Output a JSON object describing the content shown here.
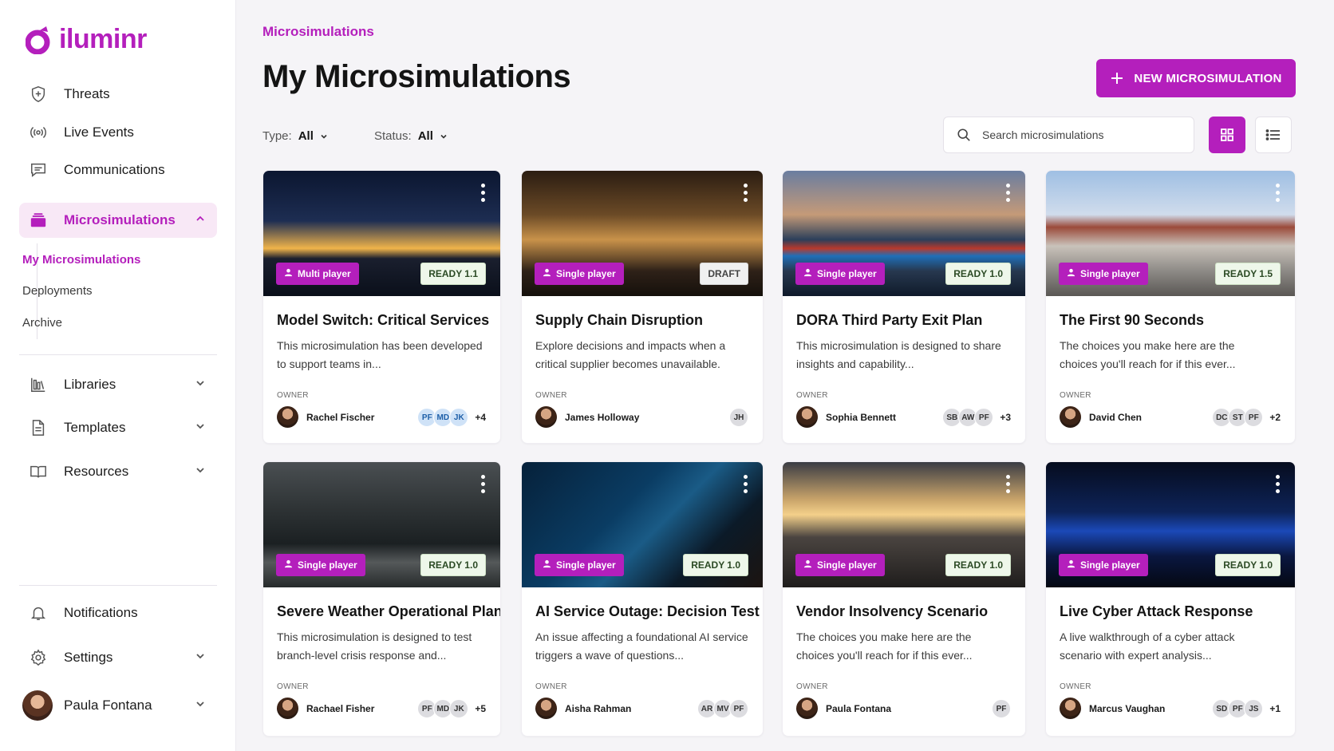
{
  "app": {
    "name": "iluminr"
  },
  "sidebar": {
    "items": [
      {
        "label": "Threats",
        "icon": "shield-icon"
      },
      {
        "label": "Live Events",
        "icon": "broadcast-icon"
      },
      {
        "label": "Communications",
        "icon": "message-icon"
      },
      {
        "label": "Microsimulations",
        "icon": "stack-icon"
      },
      {
        "label": "Libraries",
        "icon": "library-icon"
      },
      {
        "label": "Templates",
        "icon": "document-icon"
      },
      {
        "label": "Resources",
        "icon": "book-icon"
      },
      {
        "label": "Notifications",
        "icon": "bell-icon"
      },
      {
        "label": "Settings",
        "icon": "gear-icon"
      }
    ],
    "sub_items": [
      "My Microsimulations",
      "Deployments",
      "Archive"
    ],
    "user": {
      "name": "Paula Fontana"
    }
  },
  "header": {
    "breadcrumb": "Microsimulations",
    "title": "My Microsimulations",
    "new_button": "NEW MICROSIMULATION"
  },
  "filters": {
    "type_label": "Type:",
    "type_value": "All",
    "status_label": "Status:",
    "status_value": "All"
  },
  "search": {
    "placeholder": "Search microsimulations"
  },
  "owner_label": "OWNER",
  "colors": {
    "accent": "#b41fbc"
  },
  "cards": [
    {
      "title": "Model Switch: Critical Services",
      "desc": "This microsimulation has been developed to support teams in...",
      "mode": "Multi player",
      "status": "READY 1.1",
      "owner": "Rachel Fischer",
      "collabs": [
        "PF",
        "MD",
        "JK"
      ],
      "more": "+4"
    },
    {
      "title": "Supply Chain Disruption",
      "desc": "Explore decisions and impacts when a critical supplier becomes unavailable.",
      "mode": "Single player",
      "status": "DRAFT",
      "owner": "James Holloway",
      "collabs": [
        "JH"
      ],
      "more": ""
    },
    {
      "title": "DORA Third Party Exit Plan",
      "desc": "This microsimulation is designed to share insights and capability...",
      "mode": "Single player",
      "status": "READY 1.0",
      "owner": "Sophia Bennett",
      "collabs": [
        "SB",
        "AW",
        "PF"
      ],
      "more": "+3"
    },
    {
      "title": "The First 90 Seconds",
      "desc": "The choices you make here are the choices you'll reach for if this ever...",
      "mode": "Single player",
      "status": "READY 1.5",
      "owner": "David Chen",
      "collabs": [
        "DC",
        "ST",
        "PF"
      ],
      "more": "+2"
    },
    {
      "title": "Severe Weather Operational Plan",
      "desc": "This microsimulation is designed to test branch-level crisis response and...",
      "mode": "Single player",
      "status": "READY 1.0",
      "owner": "Rachael Fisher",
      "collabs": [
        "PF",
        "MD",
        "JK"
      ],
      "more": "+5"
    },
    {
      "title": "AI Service Outage: Decision Test",
      "desc": "An issue affecting a foundational AI service triggers a wave of questions...",
      "mode": "Single player",
      "status": "READY 1.0",
      "owner": "Aisha Rahman",
      "collabs": [
        "AR",
        "MV",
        "PF"
      ],
      "more": ""
    },
    {
      "title": "Vendor Insolvency Scenario",
      "desc": "The choices you make here are the choices you'll reach for if this ever...",
      "mode": "Single player",
      "status": "READY 1.0",
      "owner": "Paula Fontana",
      "collabs": [
        "PF"
      ],
      "more": ""
    },
    {
      "title": "Live Cyber Attack Response",
      "desc": "A live walkthrough of a cyber attack scenario with expert analysis...",
      "mode": "Single player",
      "status": "READY 1.0",
      "owner": "Marcus Vaughan",
      "collabs": [
        "SD",
        "PF",
        "JS"
      ],
      "more": "+1"
    }
  ]
}
